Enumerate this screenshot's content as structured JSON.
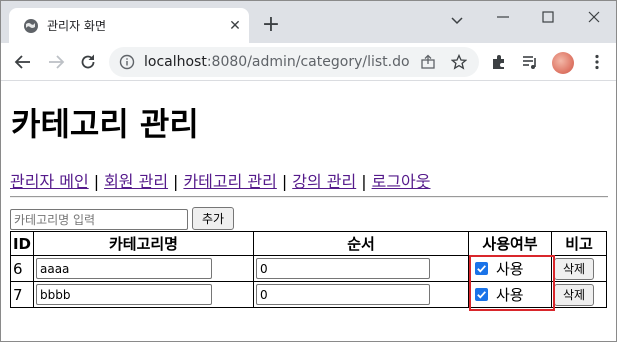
{
  "browser": {
    "tab_title": "관리자 화면",
    "url_host": "localhost",
    "url_path": ":8080/admin/category/list.do"
  },
  "page": {
    "heading": "카테고리 관리",
    "nav": [
      {
        "label": "관리자 메인"
      },
      {
        "label": "회원 관리"
      },
      {
        "label": "카테고리 관리"
      },
      {
        "label": "강의 관리"
      },
      {
        "label": "로그아웃"
      }
    ],
    "nav_separator": "|",
    "add_form": {
      "placeholder": "카테고리명 입력",
      "button_label": "추가"
    },
    "table": {
      "headers": [
        "ID",
        "카테고리명",
        "순서",
        "사용여부",
        "비고"
      ],
      "rows": [
        {
          "id": "6",
          "name": "aaaa",
          "order": "0",
          "use_checked": true,
          "use_label": "사용",
          "delete_label": "삭제"
        },
        {
          "id": "7",
          "name": "bbbb",
          "order": "0",
          "use_checked": true,
          "use_label": "사용",
          "delete_label": "삭제"
        }
      ]
    },
    "colors": {
      "highlight": "#d9262b",
      "visited_link": "#551a8b",
      "checkbox": "#1a73e8"
    }
  }
}
